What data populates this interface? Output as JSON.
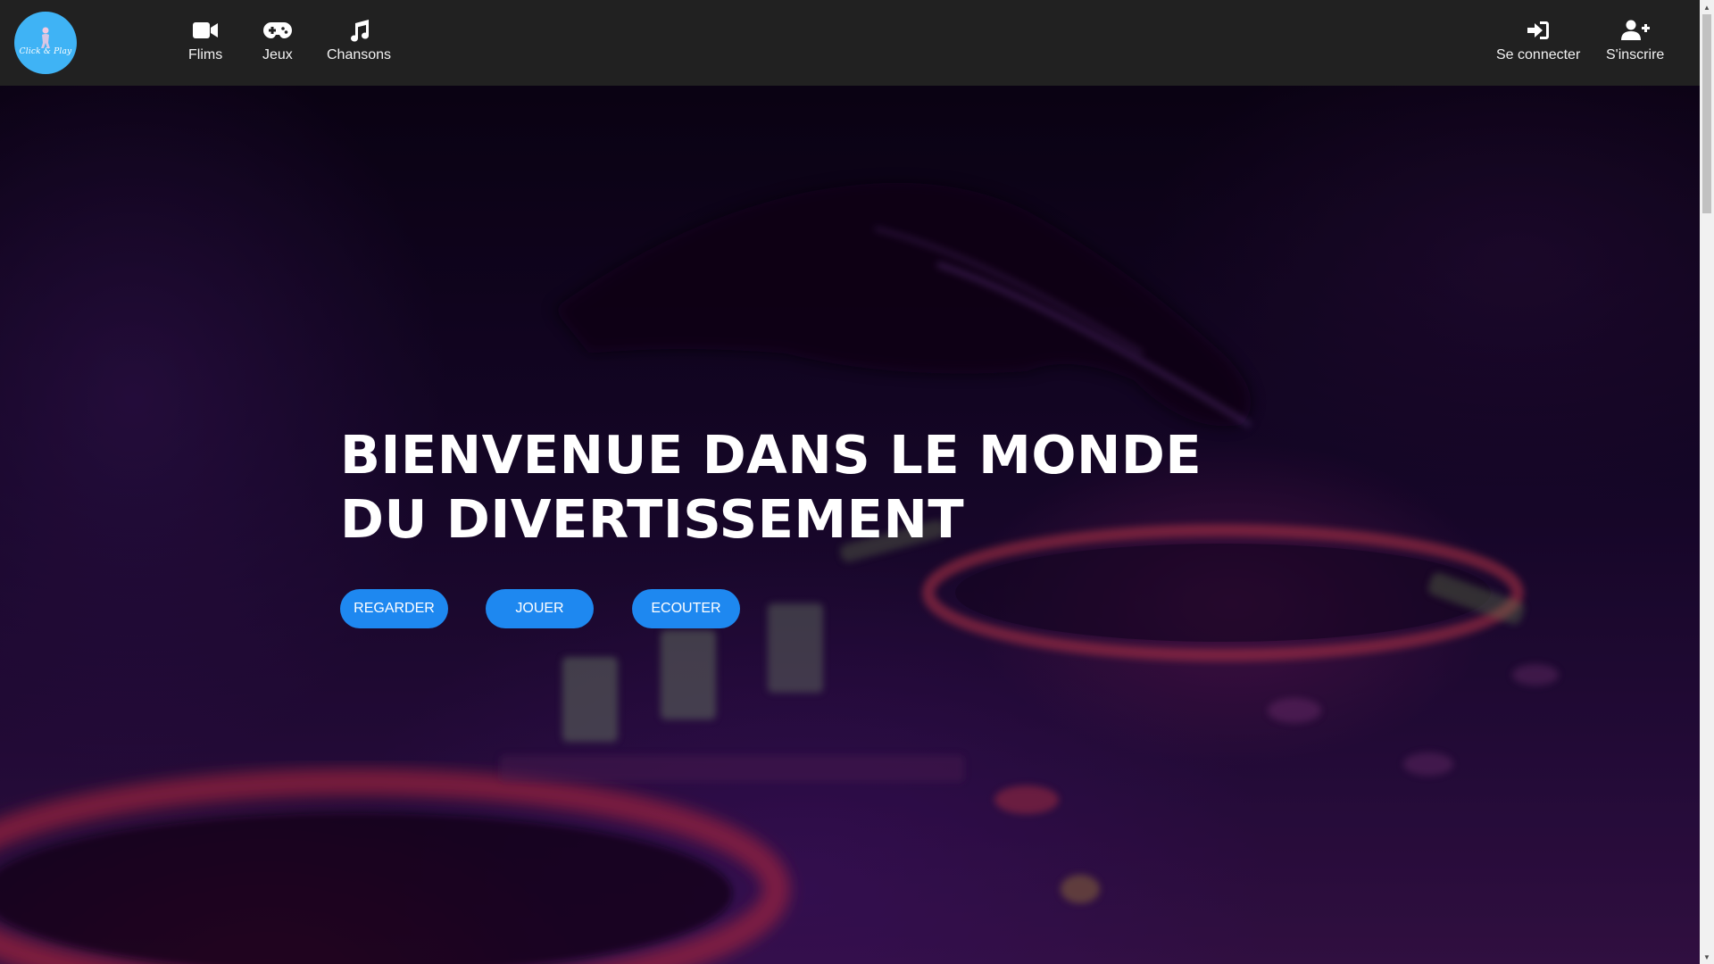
{
  "brand": {
    "logo_text": "Click & Play"
  },
  "nav": {
    "left": [
      {
        "label": "Flims",
        "icon": "video-camera-icon"
      },
      {
        "label": "Jeux",
        "icon": "gamepad-icon"
      },
      {
        "label": "Chansons",
        "icon": "music-note-icon"
      }
    ],
    "right": [
      {
        "label": "Se connecter",
        "icon": "sign-in-icon"
      },
      {
        "label": "S'inscrire",
        "icon": "user-plus-icon"
      }
    ]
  },
  "hero": {
    "title": "BIENVENUE DANS LE MONDE DU DIVERTISSEMENT",
    "buttons": [
      {
        "label": "REGARDER"
      },
      {
        "label": "JOUER"
      },
      {
        "label": "ECOUTER"
      }
    ],
    "background": "dj-turntable-photo"
  },
  "colors": {
    "navbar": "#212121",
    "logo": "#3fb3f5",
    "button": "#1e88f0"
  }
}
